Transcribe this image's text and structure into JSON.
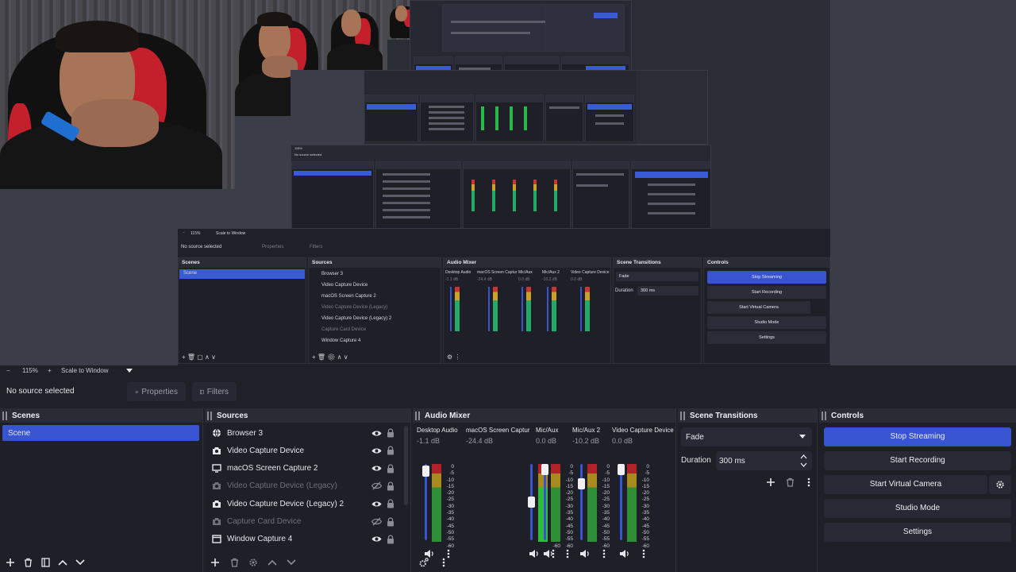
{
  "preview": {
    "zoom": "115%",
    "scale_mode": "Scale to Window",
    "nested": {
      "zoom": "115%",
      "scale_mode": "Scale to Window",
      "no_source": "No source selected",
      "properties": "Properties",
      "filters": "Filters",
      "scenes_title": "Scenes",
      "sources_title": "Sources",
      "mixer_title": "Audio Mixer",
      "transitions_title": "Scene Transitions",
      "controls_title": "Controls",
      "scene_item": "Scene",
      "sources": [
        "Browser 3",
        "Video Capture Device",
        "macOS Screen Capture 2",
        "Video Capture Device (Legacy)",
        "Video Capture Device (Legacy) 2",
        "Capture Card Device",
        "Window Capture 4"
      ],
      "channels": [
        {
          "name": "Desktop Audio",
          "db": "-1.1 dB"
        },
        {
          "name": "macOS Screen Captur",
          "db": "-24.4 dB"
        },
        {
          "name": "Mic/Aux",
          "db": "0.0 dB"
        },
        {
          "name": "Mic/Aux 2",
          "db": "-10.2 dB"
        },
        {
          "name": "Video Capture Device",
          "db": "0.0 dB"
        }
      ],
      "transition": "Fade",
      "duration_label": "Duration",
      "duration": "300 ms",
      "buttons": [
        "Stop Streaming",
        "Start Recording",
        "Start Virtual Camera",
        "Studio Mode",
        "Settings"
      ]
    }
  },
  "toolbar": {
    "zoom_minus": "−",
    "zoom": "115%",
    "zoom_plus": "+",
    "scale_mode": "Scale to Window",
    "no_source": "No source selected",
    "properties": "Properties",
    "filters": "Filters"
  },
  "scenes": {
    "title": "Scenes",
    "items": [
      "Scene"
    ]
  },
  "sources": {
    "title": "Sources",
    "items": [
      {
        "label": "Browser 3",
        "icon": "globe-icon",
        "visible": true
      },
      {
        "label": "Video Capture Device",
        "icon": "camera-icon",
        "visible": true
      },
      {
        "label": "macOS Screen Capture 2",
        "icon": "monitor-icon",
        "visible": true
      },
      {
        "label": "Video Capture Device (Legacy)",
        "icon": "camera-icon",
        "visible": false
      },
      {
        "label": "Video Capture Device (Legacy) 2",
        "icon": "camera-icon",
        "visible": true
      },
      {
        "label": "Capture Card Device",
        "icon": "camera-icon",
        "visible": false
      },
      {
        "label": "Window Capture 4",
        "icon": "window-icon",
        "visible": true
      }
    ]
  },
  "mixer": {
    "title": "Audio Mixer",
    "scale": [
      "0",
      "-5",
      "-10",
      "-15",
      "-20",
      "-25",
      "-30",
      "-35",
      "-40",
      "-45",
      "-50",
      "-55",
      "-60"
    ],
    "channels": [
      {
        "name": "Desktop Audio",
        "db": "-1.1 dB",
        "fader": 0.98
      },
      {
        "name": "macOS Screen Captur",
        "db": "-24.4 dB",
        "fader": 0.5
      },
      {
        "name": "Mic/Aux",
        "db": "0.0 dB",
        "fader": 1.0
      },
      {
        "name": "Mic/Aux 2",
        "db": "-10.2 dB",
        "fader": 0.78
      },
      {
        "name": "Video Capture Device",
        "db": "0.0 dB",
        "fader": 1.0
      }
    ]
  },
  "transitions": {
    "title": "Scene Transitions",
    "type": "Fade",
    "duration_label": "Duration",
    "duration": "300 ms"
  },
  "controls": {
    "title": "Controls",
    "stop_streaming": "Stop Streaming",
    "start_recording": "Start Recording",
    "start_virtual_camera": "Start Virtual Camera",
    "studio_mode": "Studio Mode",
    "settings": "Settings"
  },
  "colors": {
    "accent": "#3854d1",
    "background": "#1f2028",
    "dock": "#1e1f27"
  }
}
